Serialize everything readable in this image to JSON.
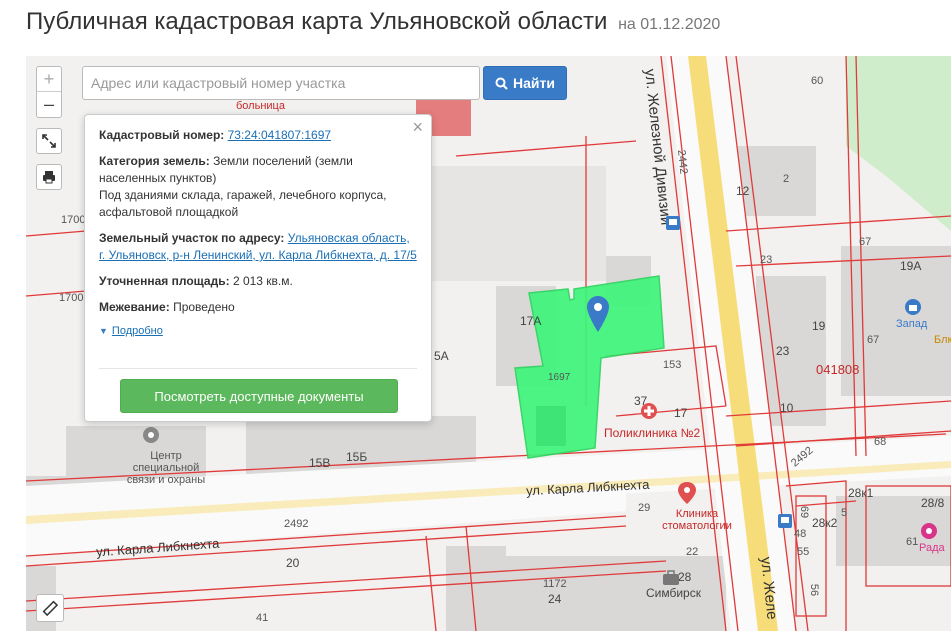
{
  "header": {
    "title": "Публичная кадастровая карта Ульяновской области",
    "date": "на 01.12.2020"
  },
  "toolbar": {
    "zoom_in": "+",
    "zoom_out": "–",
    "search_placeholder": "Адрес или кадастровый номер участка",
    "search_button": "Найти"
  },
  "popup": {
    "cadastral_label": "Кадастровый номер:",
    "cadastral_value": "73:24:041807:1697",
    "category_label": "Категория земель:",
    "category_value": "Земли поселений (земли населенных пунктов)",
    "usage_value": "Под зданиями склада, гаражей, лечебного корпуса, асфальтовой площадкой",
    "address_label": "Земельный участок по адресу:",
    "address_value": "Ульяновская область, г. Ульяновск, р-н Ленинский, ул. Карла Либкнехта, д. 17/5",
    "area_label": "Уточненная площадь:",
    "area_value": "2 013 кв.м.",
    "survey_label": "Межевание:",
    "survey_value": "Проведено",
    "details_link": "Подробно",
    "docs_button": "Посмотреть доступные документы"
  },
  "map": {
    "streets": {
      "zheleznoy_top": "ул. Железной Дивизии",
      "zheleznoy_bottom": "ул. Желе",
      "liebknecht_center": "ул. Карла Либкнехта",
      "liebknecht_left": "ул. Карла Либкнехта"
    },
    "pois": {
      "hospital": "больница",
      "comms_center": "Центр специальной связи и охраны",
      "polyclinic": "Поликлиника №2",
      "dental_clinic": "Клиника стоматологии",
      "zapad": "Запад",
      "blk": "Блк",
      "rada": "Рада",
      "simbirsk": "Симбирск"
    },
    "labels": {
      "n1700a": "1700",
      "n1700b": "1700",
      "n1697": "1697",
      "n17a": "17А",
      "n15a": "5А",
      "n15v": "15В",
      "n15b": "15Б",
      "n1534": "153",
      "n37": "37",
      "n17": "17",
      "n60": "60",
      "n12": "12",
      "n2": "2",
      "n67a": "67",
      "n67b": "67",
      "n19a": "19А",
      "n23a": "23",
      "n23b": "23",
      "n19": "19",
      "n10": "10",
      "n041808": "041808",
      "n68": "68",
      "n2442": "2442",
      "n2492a": "2492",
      "n2492b": "2492",
      "n28k1": "28к1",
      "n28_8": "28/8",
      "n5": "5",
      "n61": "61",
      "n28k2": "28к2",
      "n29": "29",
      "n20": "20",
      "n1172": "1172",
      "n24": "24",
      "n28": "28",
      "n41": "41",
      "n48": "48",
      "n55": "55",
      "n56": "56",
      "n69": "69",
      "n22": "22"
    },
    "colors": {
      "parcel_fill": "#3df57a",
      "parcel_border": "#2fd35f",
      "boundary": "#e03a3a",
      "building": "#d9d8d6",
      "road": "#fafafa",
      "main_road": "#f7dd7a",
      "park": "#cfeccb",
      "accent": "#3a7bc8",
      "button_green": "#5cb85c"
    },
    "icons": {
      "marker": "location-pin-icon",
      "search": "magnifier-icon",
      "fullscreen": "expand-icon",
      "print": "printer-icon",
      "ruler": "ruler-icon"
    }
  }
}
